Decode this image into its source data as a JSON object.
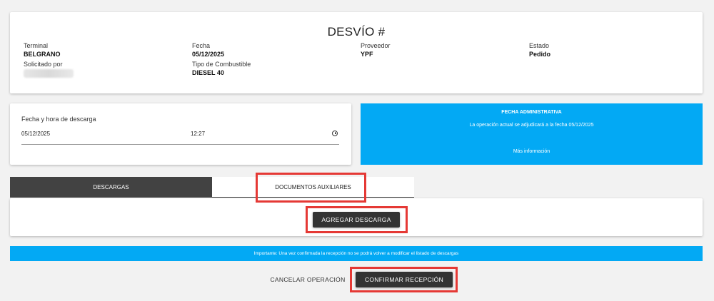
{
  "header": {
    "title": "DESVÍO #",
    "fields": {
      "terminal_label": "Terminal",
      "terminal_value": "BELGRANO",
      "solicitado_label": "Solicitado por",
      "fecha_label": "Fecha",
      "fecha_value": "05/12/2025",
      "combustible_label": "Tipo de Combustible",
      "combustible_value": "DIESEL 40",
      "proveedor_label": "Proveedor",
      "proveedor_value": "YPF",
      "estado_label": "Estado",
      "estado_value": "Pedido"
    }
  },
  "descarga": {
    "label": "Fecha y hora de descarga",
    "date_value": "05/12/2025",
    "time_value": "12:27"
  },
  "admin": {
    "title": "FECHA ADMINISTRATIVA",
    "text": "La operación actual se adjudicará a la fecha 05/12/2025",
    "link": "Más información",
    "color": "#03a9f4"
  },
  "tabs": [
    {
      "label": "DESCARGAS",
      "active": true
    },
    {
      "label": "DOCUMENTOS AUXILIARES",
      "active": false
    }
  ],
  "descargas_panel": {
    "add_button": "AGREGAR DESCARGA"
  },
  "info_bar": {
    "text": "Importante: Una vez confirmada la recepción no se podrá volver a modificar el listado de descargas"
  },
  "actions": {
    "cancel": "CANCELAR OPERACIÓN",
    "confirm": "CONFIRMAR RECEPCIÓN"
  },
  "icons": {
    "time_picker": "clock-icon"
  },
  "colors": {
    "accent": "#03a9f4",
    "dark": "#333333",
    "highlight": "#e53935"
  }
}
